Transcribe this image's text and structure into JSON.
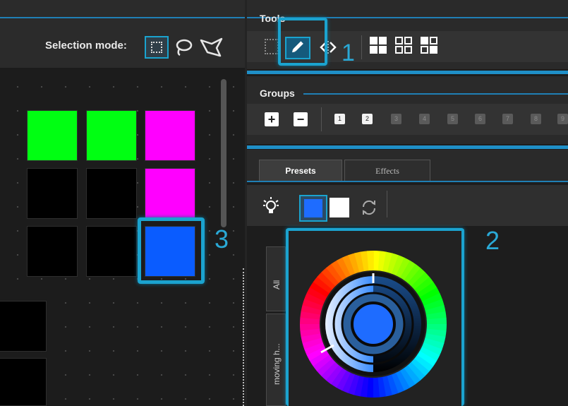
{
  "left_panel": {
    "selection_mode_label": "Selection mode:",
    "icons": [
      "rectangle-select-icon",
      "lasso-icon",
      "polygon-select-icon"
    ],
    "grid_colors": [
      [
        "#00ff12",
        "#00ff12",
        "#ff00ff"
      ],
      [
        "#000000",
        "#000000",
        "#ff00ff"
      ],
      [
        "#000000",
        "#000000",
        "#0a5cff"
      ]
    ]
  },
  "tools": {
    "title": "Tools",
    "icons": [
      "rect-select-tool-icon",
      "pencil-icon",
      "flip-icon",
      "layout-grid-1-icon",
      "layout-grid-2-icon",
      "layout-grid-3-icon"
    ]
  },
  "groups": {
    "title": "Groups",
    "add_label": "+",
    "remove_label": "−",
    "numbers": [
      "1",
      "2",
      "3",
      "4",
      "5",
      "6",
      "7",
      "8",
      "9"
    ],
    "active_count": 2
  },
  "tabs": {
    "presets": "Presets",
    "effects": "Effects"
  },
  "presets": {
    "icons": [
      "bulb-icon",
      "blue-swatch",
      "white-swatch",
      "cycle-icon"
    ],
    "selected_color": "#1e6cff",
    "side_tabs": [
      "All",
      "moving h..."
    ]
  },
  "callouts": {
    "one": "1",
    "two": "2",
    "three": "3"
  },
  "accent_color": "#1ba3cf"
}
